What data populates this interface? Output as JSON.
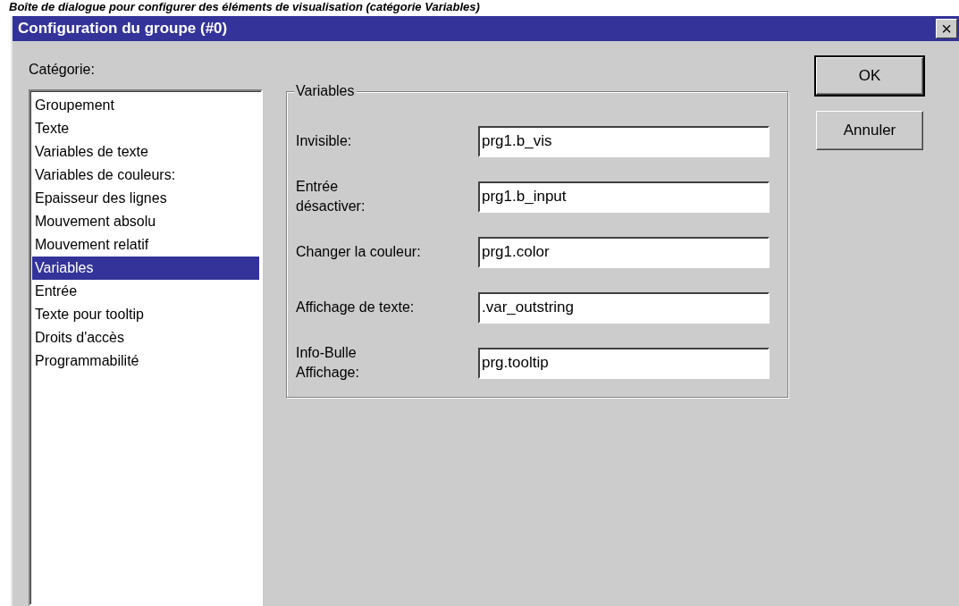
{
  "caption": "Boîte de dialogue pour configurer des éléments de visualisation (catégorie Variables)",
  "window": {
    "title": "Configuration du groupe (#0)",
    "close": "×"
  },
  "category": {
    "label": "Catégorie:",
    "items": [
      {
        "label": "Groupement",
        "selected": false
      },
      {
        "label": "Texte",
        "selected": false
      },
      {
        "label": "Variables de texte",
        "selected": false
      },
      {
        "label": "Variables de couleurs:",
        "selected": false
      },
      {
        "label": "Epaisseur des lignes",
        "selected": false
      },
      {
        "label": "Mouvement absolu",
        "selected": false
      },
      {
        "label": "Mouvement relatif",
        "selected": false
      },
      {
        "label": "Variables",
        "selected": true
      },
      {
        "label": "Entrée",
        "selected": false
      },
      {
        "label": "Texte pour tooltip",
        "selected": false
      },
      {
        "label": "Droits d'accès",
        "selected": false
      },
      {
        "label": "Programmabilité",
        "selected": false
      }
    ]
  },
  "group": {
    "title": "Variables",
    "fields": [
      {
        "label": "Invisible:",
        "value": "prg1.b_vis"
      },
      {
        "label": "Entrée\ndésactiver:",
        "value": "prg1.b_input"
      },
      {
        "label": "Changer la couleur:",
        "value": "prg1.color"
      },
      {
        "label": "Affichage de texte:",
        "value": ".var_outstring"
      },
      {
        "label": "Info-Bulle\nAffichage:",
        "value": "prg.tooltip"
      }
    ]
  },
  "buttons": [
    {
      "label": "OK",
      "default": true
    },
    {
      "label": "Annuler",
      "default": false
    }
  ]
}
